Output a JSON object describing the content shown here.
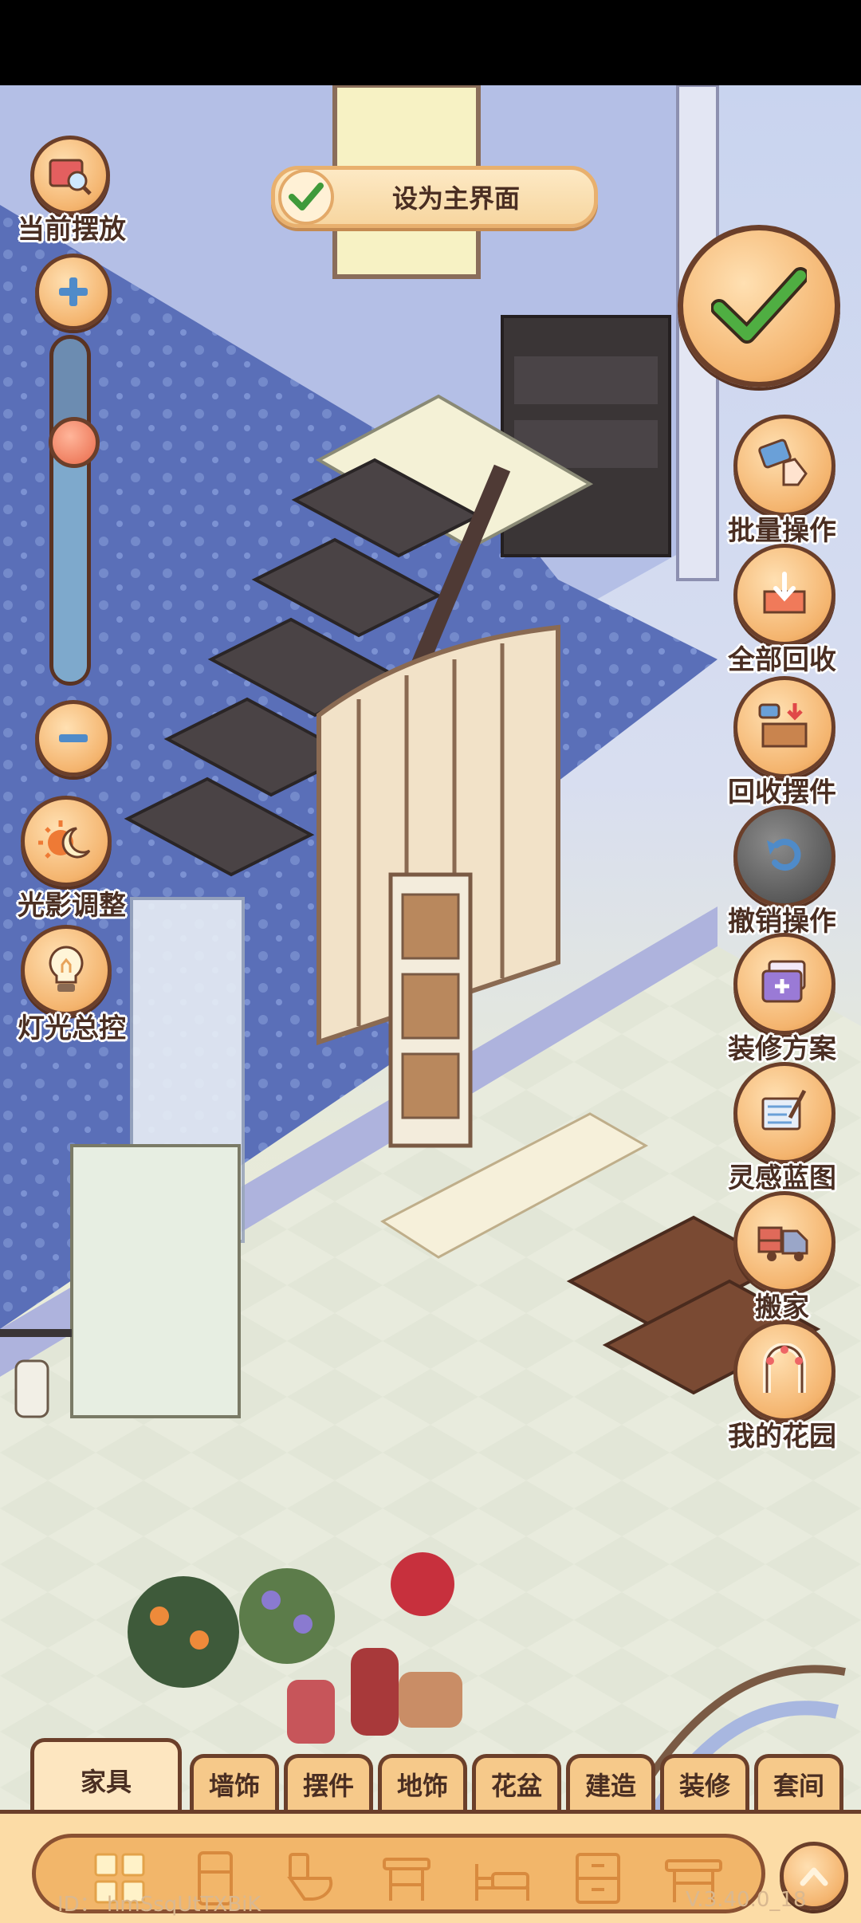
{
  "top_bar": {
    "set_main_label": "设为主界面"
  },
  "left_controls": {
    "current_placement": "当前摆放",
    "zoom_level": 0.74,
    "light_adjust": "光影调整",
    "light_master": "灯光总控"
  },
  "right_controls": [
    {
      "label": "批量操作",
      "icon": "batch-hand-icon"
    },
    {
      "label": "全部回收",
      "icon": "recycle-all-icon"
    },
    {
      "label": "回收摆件",
      "icon": "recycle-box-icon"
    },
    {
      "label": "撤销操作",
      "icon": "undo-icon"
    },
    {
      "label": "装修方案",
      "icon": "folder-plus-icon"
    },
    {
      "label": "灵感蓝图",
      "icon": "blueprint-icon"
    },
    {
      "label": "搬家",
      "icon": "truck-icon"
    },
    {
      "label": "我的花园",
      "icon": "garden-arch-icon"
    }
  ],
  "tabs": [
    "家具",
    "墙饰",
    "摆件",
    "地饰",
    "花盆",
    "建造",
    "装修",
    "套间"
  ],
  "active_tab": "家具",
  "tray_icons": [
    "grid-icon",
    "fridge-icon",
    "toilet-icon",
    "stool-icon",
    "bed-icon",
    "cabinet-icon",
    "table-icon"
  ],
  "footer": {
    "id": "ID： hmSsqUtTXBiK",
    "version": "V.3.40.0_18"
  },
  "colors": {
    "accent": "#f4b46e",
    "outline": "#6b3f2a",
    "check_green": "#3f9a3a"
  }
}
